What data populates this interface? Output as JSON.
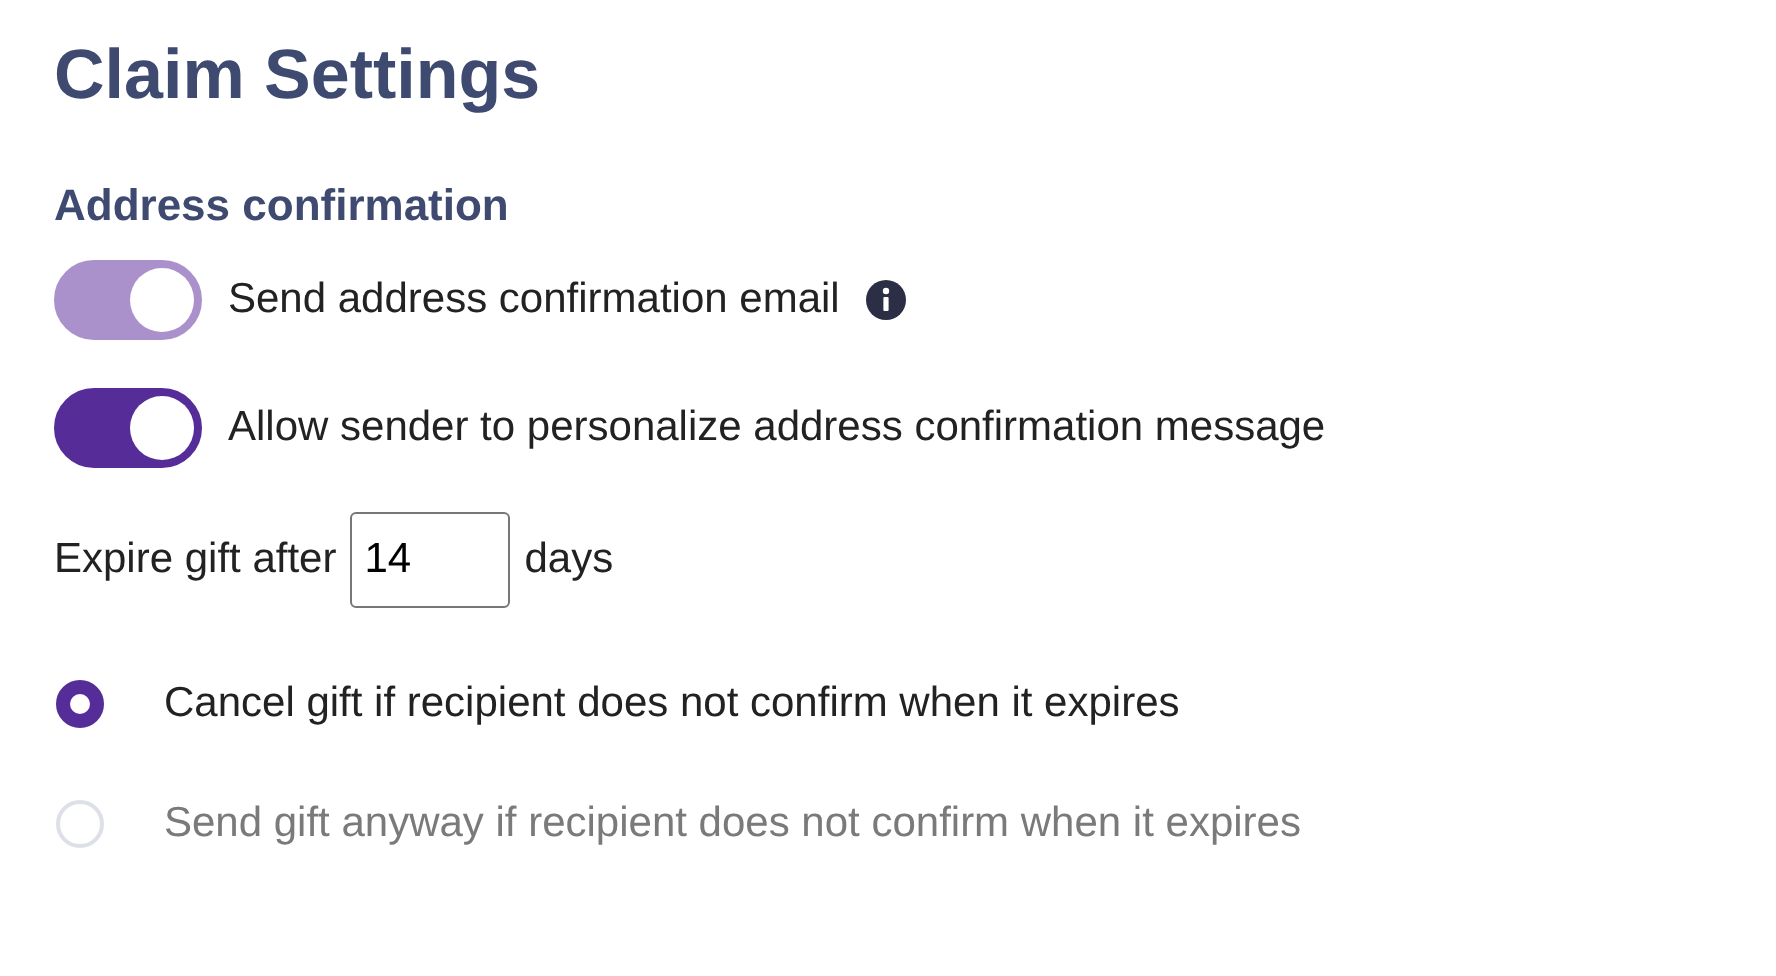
{
  "title": "Claim Settings",
  "section": "Address confirmation",
  "toggles": [
    {
      "label": "Send address confirmation email",
      "on": true,
      "disabled": true,
      "info": true
    },
    {
      "label": "Allow sender to personalize address confirmation message",
      "on": true,
      "disabled": false,
      "info": false
    }
  ],
  "expire": {
    "prefix": "Expire gift after",
    "value": "14",
    "suffix": "days"
  },
  "options": [
    {
      "label": "Cancel gift if recipient does not confirm when it expires",
      "selected": true
    },
    {
      "label": "Send gift anyway if recipient does not confirm when it expires",
      "selected": false
    }
  ]
}
